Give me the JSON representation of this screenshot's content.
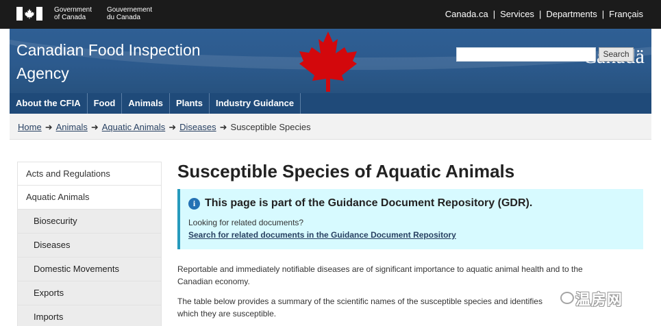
{
  "federal_bar": {
    "gov_en": [
      "Government",
      "of Canada"
    ],
    "gov_fr": [
      "Gouvernement",
      "du Canada"
    ],
    "links": [
      "Canada.ca",
      "Services",
      "Departments",
      "Français"
    ]
  },
  "banner": {
    "site_title_line1": "Canadian Food Inspection",
    "site_title_line2": "Agency",
    "wordmark": "Canadä",
    "search_value": "",
    "search_button": "Search"
  },
  "menu": [
    "About the CFIA",
    "Food",
    "Animals",
    "Plants",
    "Industry Guidance"
  ],
  "breadcrumb": [
    "Home",
    "Animals",
    "Aquatic Animals",
    "Diseases",
    "Susceptible Species"
  ],
  "sidenav": [
    {
      "label": "Acts and Regulations",
      "level": 1
    },
    {
      "label": "Aquatic Animals",
      "level": 1
    },
    {
      "label": "Biosecurity",
      "level": 2
    },
    {
      "label": "Diseases",
      "level": 2
    },
    {
      "label": "Domestic Movements",
      "level": 2
    },
    {
      "label": "Exports",
      "level": 2
    },
    {
      "label": "Imports",
      "level": 2
    }
  ],
  "main": {
    "title": "Susceptible Species of Aquatic Animals",
    "alert": {
      "icon": "i",
      "heading": "This page is part of the Guidance Document Repository (GDR).",
      "line": "Looking for related documents?",
      "link": "Search for related documents in the Guidance Document Repository"
    },
    "para1_line1": "Reportable and immediately notifiable diseases are of significant importance to aquatic animal health and to the",
    "para1_line2": "Canadian economy.",
    "para2_line1": "The table below provides a summary of the scientific names of the susceptible species and identifies",
    "para2_line2": "which they are susceptible."
  },
  "watermark": {
    "text": "温房网"
  },
  "colors": {
    "fip": "#1b1b1b",
    "banner": "#2f5f94",
    "menu": "#1f4a79",
    "alert_bg": "#d7faff",
    "alert_border": "#269abc",
    "leaf": "#d3080c"
  }
}
